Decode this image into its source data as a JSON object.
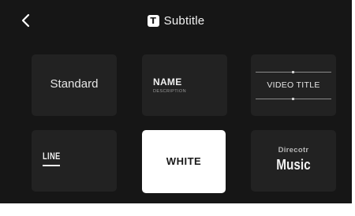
{
  "header": {
    "title": "Subtitle",
    "title_icon_glyph": "T",
    "back_icon": "chevron-left-icon"
  },
  "templates": [
    {
      "id": "standard",
      "label": "Standard"
    },
    {
      "id": "name",
      "label": "NAME",
      "sublabel": "DESCRIPTION"
    },
    {
      "id": "video-title",
      "label": "VIDEO TITLE"
    },
    {
      "id": "line",
      "label": "LINE"
    },
    {
      "id": "white",
      "label": "WHITE",
      "selected": true
    },
    {
      "id": "director-music",
      "label": "Direcotr",
      "sublabel": "Music"
    }
  ],
  "colors": {
    "background": "#161616",
    "tile": "#222222",
    "tile_selected": "#ffffff"
  }
}
